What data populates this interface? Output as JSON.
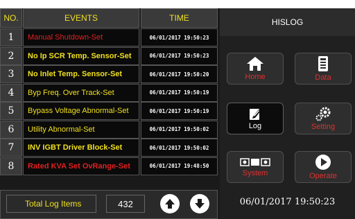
{
  "table": {
    "headers": {
      "no": "NO.",
      "events": "EVENTS",
      "time": "TIME"
    },
    "rows": [
      {
        "no": "1",
        "event": "Manual Shutdown-Set",
        "time": "06/01/2017 19:50:23",
        "color": "#e02020",
        "bold": false
      },
      {
        "no": "2",
        "event": "No Ip SCR Temp. Sensor-Set",
        "time": "06/01/2017 19:50:23",
        "color": "#f0e020",
        "bold": true
      },
      {
        "no": "3",
        "event": "No Inlet Temp. Sensor-Set",
        "time": "06/01/2017 19:50:20",
        "color": "#f0e020",
        "bold": true
      },
      {
        "no": "4",
        "event": "Byp Freq. Over Track-Set",
        "time": "06/01/2017 19:50:19",
        "color": "#f0e020",
        "bold": false
      },
      {
        "no": "5",
        "event": "Bypass Voltage Abnormal-Set",
        "time": "06/01/2017 19:50:19",
        "color": "#f0e020",
        "bold": false
      },
      {
        "no": "6",
        "event": "Utility Abnormal-Set",
        "time": "06/01/2017 19:50:02",
        "color": "#f0e020",
        "bold": false
      },
      {
        "no": "7",
        "event": "INV IGBT Driver Block-Set",
        "time": "06/01/2017 19:50:02",
        "color": "#f0e020",
        "bold": true
      },
      {
        "no": "8",
        "event": "Rated KVA Set OvRange-Set",
        "time": "06/01/2017 19:48:50",
        "color": "#e02020",
        "bold": true
      }
    ]
  },
  "footer": {
    "total_label": "Total Log Items",
    "total_value": "432",
    "up_icon": "arrow-up-icon",
    "down_icon": "arrow-down-icon"
  },
  "panel": {
    "title": "HISLOG",
    "buttons": {
      "home": "Home",
      "data": "Data",
      "log": "Log",
      "setting": "Setting",
      "system": "System",
      "operate": "Operate"
    },
    "datetime": "06/01/2017  19:50:23"
  },
  "colors": {
    "accent": "#f0e020",
    "alert": "#e02020",
    "background": "#1a1a1a"
  }
}
